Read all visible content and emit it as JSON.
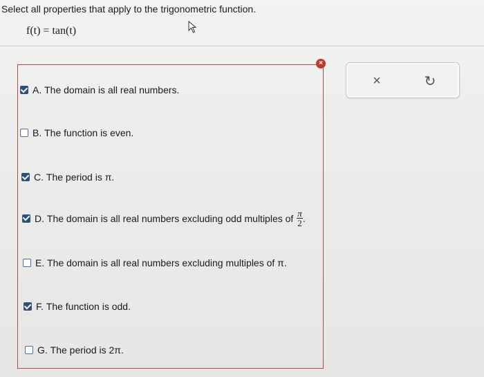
{
  "question": {
    "prompt": "Select all properties that apply to the trigonometric function.",
    "formula": "f(t) = tan(t)"
  },
  "options": [
    {
      "letter": "A.",
      "text": "The domain is all real numbers.",
      "checked": true
    },
    {
      "letter": "B.",
      "text": "The function is even.",
      "checked": false
    },
    {
      "letter": "C.",
      "text": "The period is π.",
      "checked": true
    },
    {
      "letter": "D.",
      "text": "The domain is all real numbers excluding odd multiples of",
      "checked": true,
      "frac_num": "π",
      "frac_den": "2",
      "suffix": "."
    },
    {
      "letter": "E.",
      "text": "The domain is all real numbers excluding multiples of π.",
      "checked": false
    },
    {
      "letter": "F.",
      "text": "The function is odd.",
      "checked": true
    },
    {
      "letter": "G.",
      "text": "The period is 2π.",
      "checked": false
    }
  ],
  "status": {
    "error_icon": "×"
  },
  "toolbar": {
    "clear_icon": "×",
    "reset_icon": "↻"
  },
  "colors": {
    "box_border": "#b24a4a",
    "checkbox": "#2d4f7a",
    "error": "#c0392b"
  }
}
